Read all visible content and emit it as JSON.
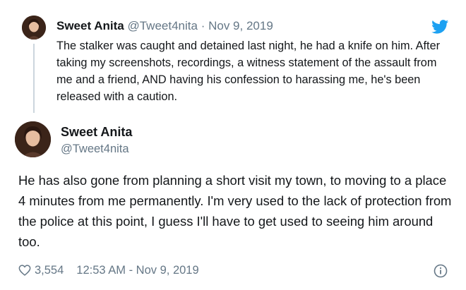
{
  "parent_tweet": {
    "name": "Sweet Anita",
    "handle": "@Tweet4nita",
    "separator": "·",
    "date": "Nov 9, 2019",
    "text": "The stalker was caught and detained last night, he had a knife on him. After taking my screenshots, recordings, a witness statement of the assault from me and a friend, AND having his confession to harassing me, he's been released with a caution."
  },
  "main_tweet": {
    "name": "Sweet Anita",
    "handle": "@Tweet4nita",
    "text": "He has also gone from planning a short visit my town, to moving to a place 4 minutes from me permanently. I'm very used to the lack of protection from the police at this point, I guess I'll have to get used to seeing him around too.",
    "likes": "3,554",
    "timestamp": "12:53 AM - Nov 9, 2019"
  },
  "icons": {
    "brand": "twitter-bird-icon",
    "like": "heart-icon",
    "info": "info-icon"
  },
  "colors": {
    "text": "#14171a",
    "secondary": "#657786",
    "twitter_blue": "#1da1f2",
    "thread_line": "#ccd6dd"
  }
}
